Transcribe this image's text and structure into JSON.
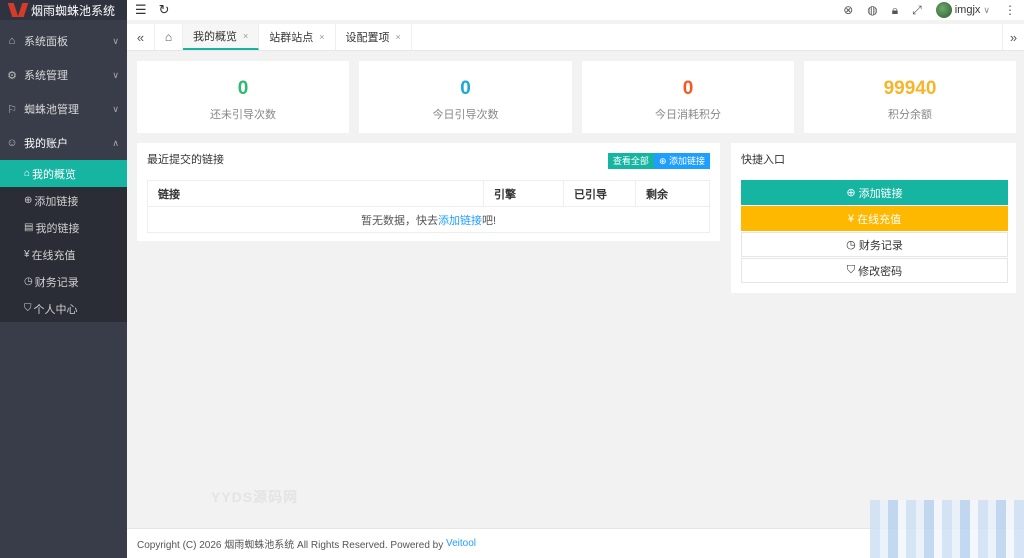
{
  "app": {
    "title": "烟雨蜘蛛池系统"
  },
  "sidebar": {
    "groups": [
      {
        "label": "系统面板",
        "icon": "home-icon",
        "arrow": "∨"
      },
      {
        "label": "系统管理",
        "icon": "gear-icon",
        "arrow": "∨"
      },
      {
        "label": "蜘蛛池管理",
        "icon": "flag-icon",
        "arrow": "∨"
      },
      {
        "label": "我的账户",
        "icon": "user-icon",
        "arrow": "∧"
      }
    ],
    "subitems": [
      {
        "label": "我的概览",
        "icon": "home-icon",
        "active": true
      },
      {
        "label": "添加链接",
        "icon": "plus-circle-icon"
      },
      {
        "label": "我的链接",
        "icon": "document-icon"
      },
      {
        "label": "在线充值",
        "icon": "yen-circle-icon"
      },
      {
        "label": "财务记录",
        "icon": "clock-icon"
      },
      {
        "label": "个人中心",
        "icon": "shield-icon"
      }
    ]
  },
  "topbar": {
    "username": "imgjx",
    "username_arrow": "∨",
    "icons": [
      "menu-icon",
      "refresh-icon",
      "close-circle-icon",
      "theme-icon",
      "lock-icon",
      "fullscreen-icon",
      "more-icon"
    ]
  },
  "tabs": [
    {
      "label": "我的概览",
      "active": true
    },
    {
      "label": "站群站点"
    },
    {
      "label": "设配置项"
    }
  ],
  "tab_close": "×",
  "stats": [
    {
      "value": "0",
      "label": "还未引导次数",
      "color": "#2eb872"
    },
    {
      "value": "0",
      "label": "今日引导次数",
      "color": "#1ba8d9"
    },
    {
      "value": "0",
      "label": "今日消耗积分",
      "color": "#f05a28"
    },
    {
      "value": "99940",
      "label": "积分余额",
      "color": "#f7b52c"
    }
  ],
  "recent": {
    "title": "最近提交的链接",
    "view_all": "查看全部",
    "add_link": "添加链接",
    "columns": [
      "链接",
      "引擎",
      "已引导",
      "剩余"
    ],
    "empty_prefix": "暂无数据，快去",
    "empty_link": "添加链接",
    "empty_suffix": "吧!"
  },
  "quick": {
    "title": "快捷入口",
    "buttons": [
      {
        "label": "添加链接",
        "icon": "⊕",
        "icon_name": "plus-circle-icon"
      },
      {
        "label": "在线充值",
        "icon": "¥",
        "icon_name": "yen-circle-icon"
      },
      {
        "label": "财务记录",
        "icon": "◷",
        "icon_name": "clock-icon"
      },
      {
        "label": "修改密码",
        "icon": "⛉",
        "icon_name": "shield-icon"
      }
    ]
  },
  "watermark": "YYDS源码网",
  "footer": {
    "prefix": "Copyright (C) 2026 烟雨蜘蛛池系统 All Rights Reserved. Powered by ",
    "link": "Veitool"
  },
  "colors": {
    "accent": "#16b5a2",
    "sidebar": "#393d49",
    "yellow": "#ffb800",
    "blue": "#1e9fff"
  }
}
